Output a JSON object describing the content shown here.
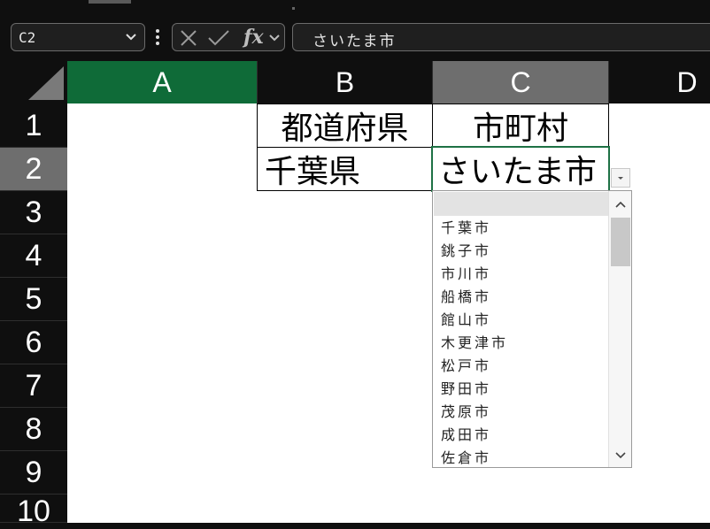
{
  "toolbar": {
    "name_box": "C2",
    "fx_label": "fx",
    "formula_value": "さいたま市"
  },
  "sheet": {
    "columns": [
      "A",
      "B",
      "C",
      "D"
    ],
    "rows": [
      "1",
      "2",
      "3",
      "4",
      "5",
      "6",
      "7",
      "8",
      "9",
      "10"
    ],
    "cells": {
      "B1": "都道府県",
      "C1": "市町村",
      "B2": "千葉県",
      "C2": "さいたま市"
    }
  },
  "dropdown": {
    "options": [
      "千葉市",
      "銚子市",
      "市川市",
      "船橋市",
      "館山市",
      "木更津市",
      "松戸市",
      "野田市",
      "茂原市",
      "成田市",
      "佐倉市"
    ]
  },
  "colors": {
    "selected_column": "#0f6b38",
    "active_header": "#6e6e6e",
    "active_cell_border": "#1e7145"
  }
}
